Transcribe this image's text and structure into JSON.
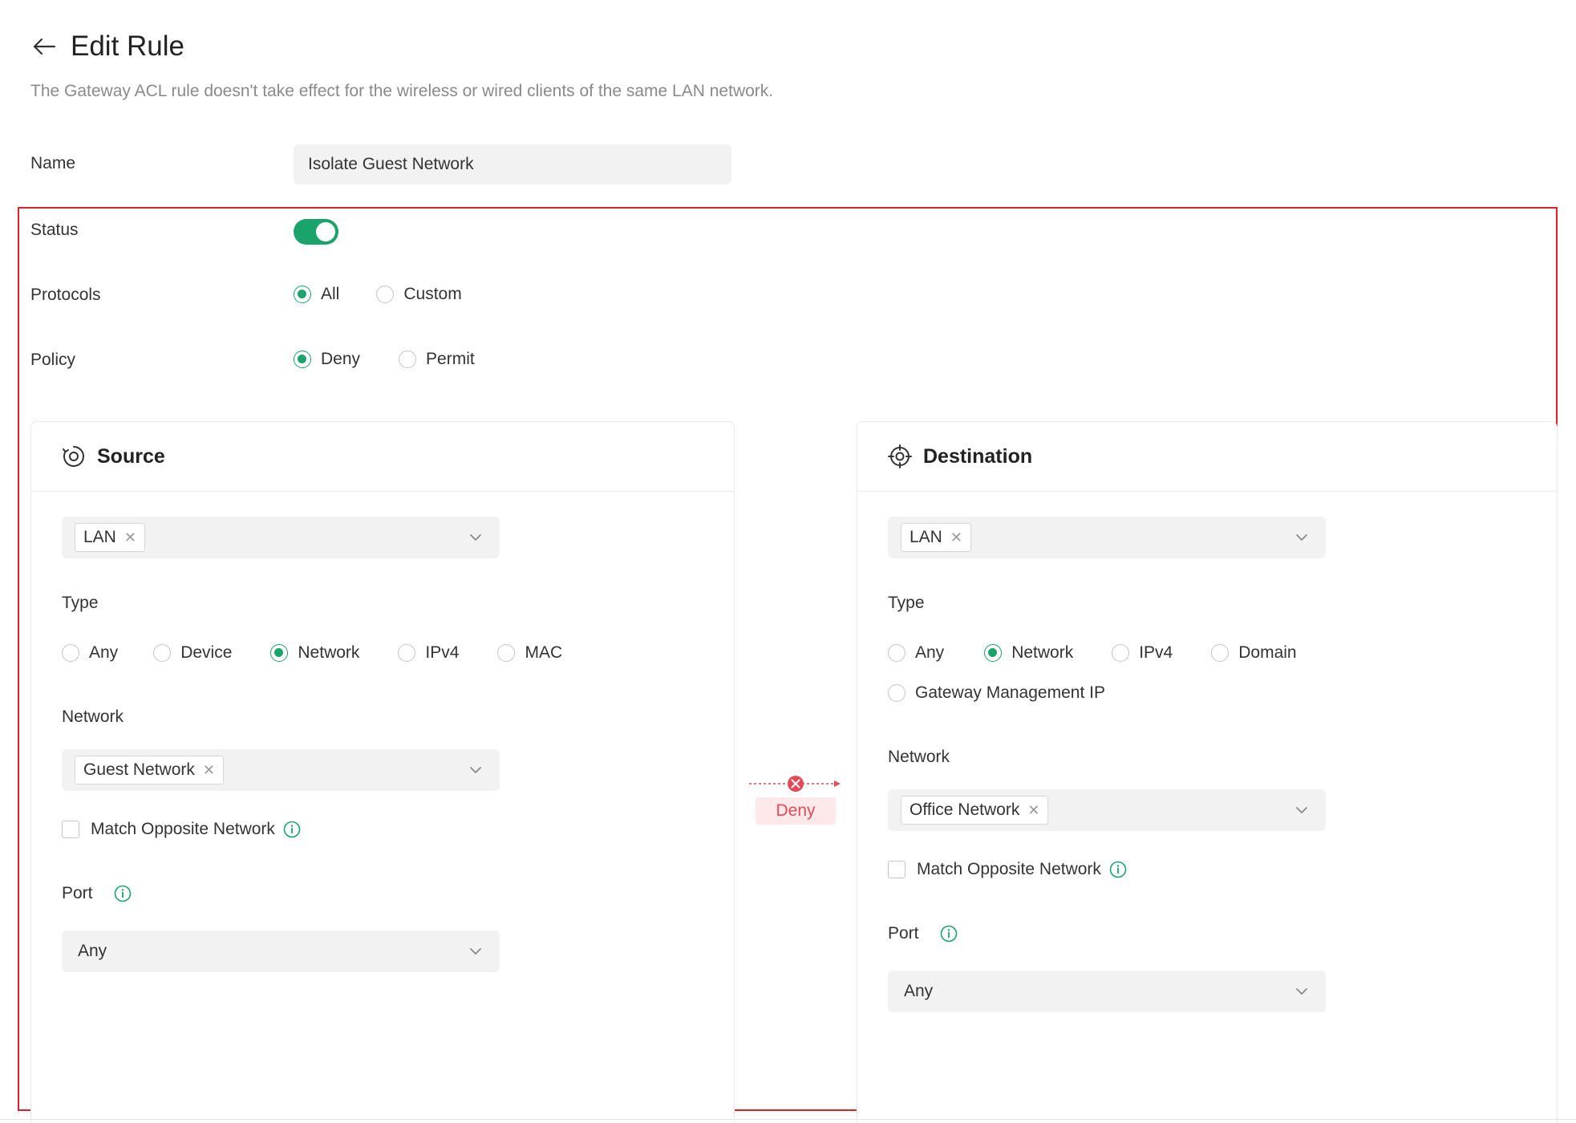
{
  "header": {
    "title": "Edit Rule",
    "subtitle": "The Gateway ACL rule doesn't take effect for the wireless or wired clients of the same LAN network."
  },
  "form": {
    "name_label": "Name",
    "name_value": "Isolate Guest Network",
    "status_label": "Status",
    "status_on": true,
    "protocols_label": "Protocols",
    "protocols_options": [
      "All",
      "Custom"
    ],
    "protocols_selected": "All",
    "policy_label": "Policy",
    "policy_options": [
      "Deny",
      "Permit"
    ],
    "policy_selected": "Deny"
  },
  "source": {
    "title": "Source",
    "interface_chip": "LAN",
    "type_label": "Type",
    "type_options": [
      "Any",
      "Device",
      "Network",
      "IPv4",
      "MAC"
    ],
    "type_selected": "Network",
    "network_label": "Network",
    "network_chip": "Guest Network",
    "match_opposite_label": "Match Opposite Network",
    "port_label": "Port",
    "port_value": "Any"
  },
  "connector": {
    "label": "Deny"
  },
  "destination": {
    "title": "Destination",
    "interface_chip": "LAN",
    "type_label": "Type",
    "type_options": [
      "Any",
      "Network",
      "IPv4",
      "Domain",
      "Gateway Management IP"
    ],
    "type_selected": "Network",
    "network_label": "Network",
    "network_chip": "Office Network",
    "match_opposite_label": "Match Opposite Network",
    "port_label": "Port",
    "port_value": "Any"
  },
  "colors": {
    "accent": "#1aa36b",
    "deny": "#e24a5a",
    "highlight": "#e0212b"
  }
}
